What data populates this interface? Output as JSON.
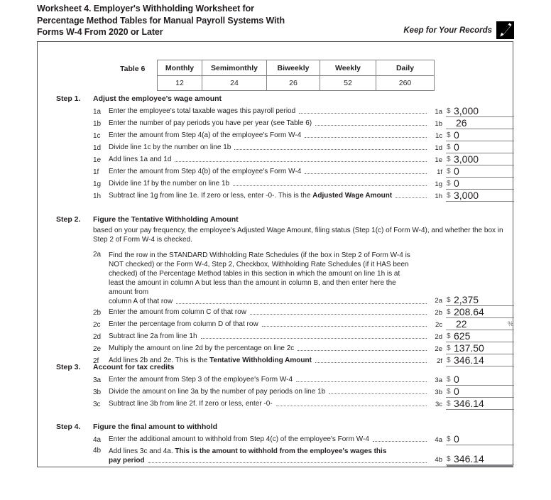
{
  "header": {
    "title_lines": [
      "Worksheet 4. Employer's Withholding Worksheet for",
      "Percentage Method Tables for Manual Payroll Systems With",
      "Forms W-4 From 2020 or Later"
    ],
    "keep_label": "Keep for Your Records",
    "keep_icon": "pen-icon"
  },
  "table6": {
    "label": "Table 6",
    "columns": [
      "Monthly",
      "Semimonthly",
      "Biweekly",
      "Weekly",
      "Daily"
    ],
    "values": [
      "12",
      "24",
      "26",
      "52",
      "260"
    ]
  },
  "steps": [
    {
      "number": "Step 1.",
      "title": "Adjust the employee's wage amount",
      "description": "",
      "lines": [
        {
          "code": "1a",
          "text": "Enter the employee's total taxable wages this payroll period",
          "num": "1a",
          "currency": "$",
          "value": "3,000",
          "suffix": ""
        },
        {
          "code": "1b",
          "text": "Enter the number of pay periods you have per year (see Table 6)",
          "num": "1b",
          "currency": "",
          "value": "26",
          "suffix": ""
        },
        {
          "code": "1c",
          "text": "Enter the amount from Step 4(a) of the employee's Form W-4",
          "num": "1c",
          "currency": "$",
          "value": "0",
          "suffix": ""
        },
        {
          "code": "1d",
          "text": "Divide line 1c by the number on line 1b",
          "num": "1d",
          "currency": "$",
          "value": "0",
          "suffix": ""
        },
        {
          "code": "1e",
          "text": "Add lines 1a and 1d",
          "num": "1e",
          "currency": "$",
          "value": "3,000",
          "suffix": ""
        },
        {
          "code": "1f",
          "text": "Enter the amount from Step 4(b) of the employee's Form W-4",
          "num": "1f",
          "currency": "$",
          "value": "0",
          "suffix": ""
        },
        {
          "code": "1g",
          "text": "Divide line 1f by the number on line 1b",
          "num": "1g",
          "currency": "$",
          "value": "0",
          "suffix": ""
        },
        {
          "code": "1h",
          "text_pre": "Subtract line 1g from line 1e. If zero or less, enter -0-. This is the ",
          "text_bold": "Adjusted Wage Amount",
          "num": "1h",
          "currency": "$",
          "value": "3,000",
          "suffix": ""
        }
      ]
    },
    {
      "number": "Step 2.",
      "title": "Figure the Tentative Withholding Amount",
      "description": "based on your pay frequency, the employee's Adjusted Wage Amount, filing status (Step 1(c) of Form W-4), and whether the box in Step 2 of Form W-4 is checked.",
      "lines": [
        {
          "code": "2a",
          "text_block": "Find the row in the STANDARD Withholding Rate Schedules (if the box in Step 2 of Form W-4 is NOT checked) or the Form W-4, Step 2, Checkbox, Withholding Rate Schedules (if it HAS been checked) of the Percentage Method tables in this section in which the amount on line 1h is at least the amount in column A but less than the amount in column B, and then enter here the amount from",
          "text_last": "column A of that row",
          "num": "2a",
          "currency": "$",
          "value": "2,375",
          "suffix": ""
        },
        {
          "code": "2b",
          "text": "Enter the amount from column C of that row",
          "num": "2b",
          "currency": "$",
          "value": "208.64",
          "suffix": ""
        },
        {
          "code": "2c",
          "text": "Enter the percentage from column D of that row",
          "num": "2c",
          "currency": "",
          "value": "22",
          "suffix": "%"
        },
        {
          "code": "2d",
          "text": "Subtract line 2a from line 1h",
          "num": "2d",
          "currency": "$",
          "value": "625",
          "suffix": ""
        },
        {
          "code": "2e",
          "text": "Multiply the amount on line 2d by the percentage on line 2c",
          "num": "2e",
          "currency": "$",
          "value": "137.50",
          "suffix": ""
        },
        {
          "code": "2f",
          "text_pre": "Add lines 2b and 2e. This is the ",
          "text_bold": "Tentative Withholding Amount",
          "num": "2f",
          "currency": "$",
          "value": "346.14",
          "suffix": ""
        }
      ]
    },
    {
      "number": "Step 3.",
      "title": "Account for tax credits",
      "description": "",
      "lines": [
        {
          "code": "3a",
          "text": "Enter the amount from Step 3 of the employee's Form W-4",
          "num": "3a",
          "currency": "$",
          "value": "0",
          "suffix": ""
        },
        {
          "code": "3b",
          "text": "Divide the amount on line 3a by the number of pay periods on line 1b",
          "num": "3b",
          "currency": "$",
          "value": "0",
          "suffix": ""
        },
        {
          "code": "3c",
          "text": "Subtract line 3b from line 2f. If zero or less, enter -0-",
          "num": "3c",
          "currency": "$",
          "value": "346.14",
          "suffix": ""
        }
      ]
    },
    {
      "number": "Step 4.",
      "title": "Figure the final amount to withhold",
      "description": "",
      "lines": [
        {
          "code": "4a",
          "text": "Enter the additional amount to withhold from Step 4(c) of the employee's Form W-4",
          "num": "4a",
          "currency": "$",
          "value": "0",
          "suffix": ""
        },
        {
          "code": "4b",
          "text_pre": "Add lines 3c and 4a. ",
          "text_bold": "This is the amount to withhold from the employee's wages this",
          "text_last_bold": "pay period",
          "num": "4b",
          "currency": "$",
          "value": "346.14",
          "suffix": "",
          "double_rule": true
        }
      ]
    }
  ]
}
